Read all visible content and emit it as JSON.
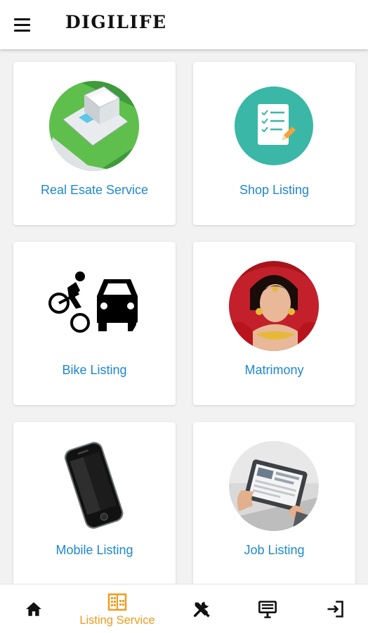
{
  "app": {
    "title": "DIGILIFE"
  },
  "header": {
    "menu_icon": "menu-icon"
  },
  "cards": [
    {
      "label": "Real Esate Service",
      "icon": "real-estate-image"
    },
    {
      "label": "Shop Listing",
      "icon": "shop-listing-icon"
    },
    {
      "label": "Bike Listing",
      "icon": "bike-car-icon"
    },
    {
      "label": "Matrimony",
      "icon": "bride-image"
    },
    {
      "label": "Mobile Listing",
      "icon": "mobile-phone-image"
    },
    {
      "label": "Job Listing",
      "icon": "job-tablet-image"
    }
  ],
  "bottom_nav": {
    "items": [
      {
        "icon": "home-icon",
        "label": ""
      },
      {
        "icon": "building-icon",
        "label": "Listing Service",
        "active": true
      },
      {
        "icon": "tools-icon",
        "label": ""
      },
      {
        "icon": "billboard-icon",
        "label": ""
      },
      {
        "icon": "logout-icon",
        "label": ""
      }
    ],
    "active_color": "#f39a1e"
  },
  "colors": {
    "label_blue": "#1e88d2",
    "accent_orange": "#f39a1e",
    "teal": "#3ab7a7"
  }
}
